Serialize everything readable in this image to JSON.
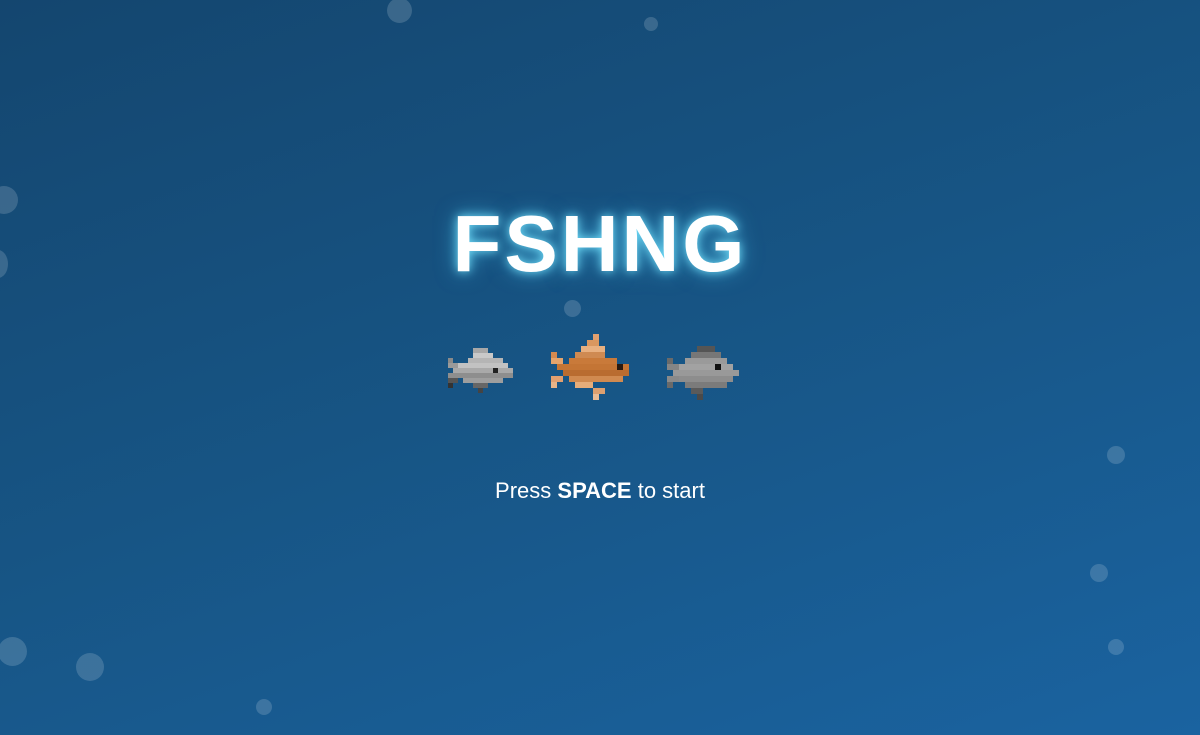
{
  "game": {
    "title": "FSHNG",
    "prompt": {
      "before": "Press",
      "key": "SPACE",
      "after": "to start"
    },
    "fish": [
      {
        "name": "grey-fish-icon",
        "color": "#9a9a9a"
      },
      {
        "name": "orange-fish-icon",
        "color": "#c97a3a"
      },
      {
        "name": "dark-grey-fish-icon",
        "color": "#8c8c8c"
      }
    ],
    "colors": {
      "background": "#175585",
      "title_glow": "#5fd8ff",
      "text": "#ffffff"
    }
  }
}
